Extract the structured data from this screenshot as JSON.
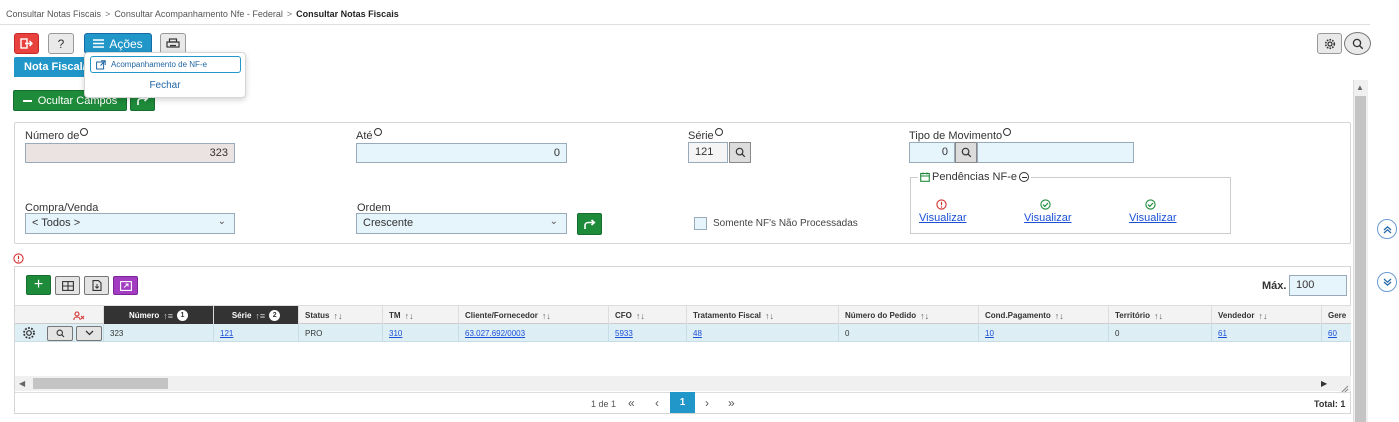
{
  "breadcrumb": {
    "items": [
      "Consultar Notas Fiscais",
      "Consultar Acompanhamento Nfe - Federal"
    ],
    "separator": ">",
    "current": "Consultar Notas Fiscais"
  },
  "toolbar": {
    "acoes_label": "Ações",
    "help_label": "?"
  },
  "tab": {
    "label": "Nota Fiscal/"
  },
  "dropdown": {
    "item1": "Acompanhamento de NF-e",
    "item2": "Fechar"
  },
  "actions": {
    "ocultar_label": "Ocultar Campos"
  },
  "form": {
    "numero_de": {
      "label": "Número de",
      "value": "323"
    },
    "ate": {
      "label": "Até",
      "value": "0"
    },
    "serie": {
      "label": "Série",
      "value": "121"
    },
    "tipo_movimento": {
      "label": "Tipo de Movimento",
      "value": "0"
    },
    "compra_venda": {
      "label": "Compra/Venda",
      "value": "< Todos >"
    },
    "ordem": {
      "label": "Ordem",
      "value": "Crescente"
    },
    "somente_label": "Somente NF's Não Processadas",
    "pendencias": {
      "title": "Pendências NF-e",
      "links": [
        "Visualizar",
        "Visualizar",
        "Visualizar"
      ]
    }
  },
  "grid": {
    "max_label": "Máx.",
    "max_value": "100",
    "columns": [
      "Número",
      "Série",
      "Status",
      "TM",
      "Cliente/Fornecedor",
      "CFO",
      "Tratamento Fiscal",
      "Número do Pedido",
      "Cond.Pagamento",
      "Território",
      "Vendedor",
      "Gere"
    ],
    "sort_badges": [
      "1",
      "2"
    ],
    "row": {
      "numero": "323",
      "serie": "121",
      "status": "PRO",
      "tm": "310",
      "cliente": "63.027.692/0003",
      "cfo": "5933",
      "tratamento": "48",
      "pedido": "0",
      "cond_pagamento": "10",
      "territorio": "0",
      "vendedor": "61",
      "gere": "60"
    }
  },
  "pager": {
    "page_info": "1 de 1",
    "first": "«",
    "prev": "‹",
    "current": "1",
    "next": "›",
    "last": "»",
    "total": "Total: 1"
  },
  "colors": {
    "primary": "#2196c9",
    "success": "#1e8b3a",
    "danger": "#e8423f",
    "accent": "#a23cc1"
  }
}
